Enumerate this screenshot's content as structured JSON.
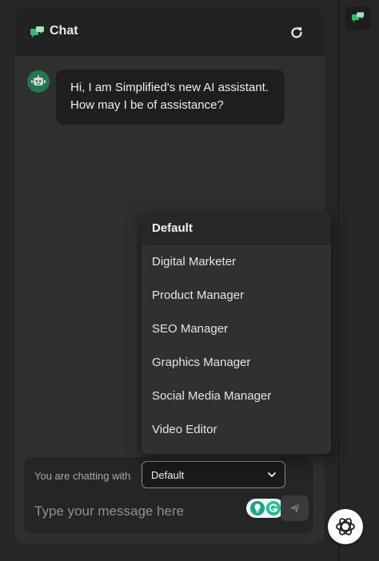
{
  "header": {
    "title": "Chat"
  },
  "message": {
    "text": "Hi, I am Simplified's new AI assistant. How may I be of assistance?"
  },
  "composer": {
    "chatting_label": "You are chatting with",
    "selected_persona": "Default",
    "placeholder": "Type your message here"
  },
  "dropdown": {
    "options": [
      "Default",
      "Digital Marketer",
      "Product Manager",
      "SEO Manager",
      "Graphics Manager",
      "Social Media Manager",
      "Video Editor"
    ]
  },
  "colors": {
    "accent": "#2fbe6c",
    "panel": "#2f2f2f",
    "header": "#222222",
    "bubble": "#1e1e1e",
    "menu": "#303030"
  },
  "icons": {
    "header": "chat-icon",
    "refresh": "refresh-icon",
    "avatar": "robot-icon",
    "send": "send-icon",
    "gpt": "openai-icon"
  }
}
